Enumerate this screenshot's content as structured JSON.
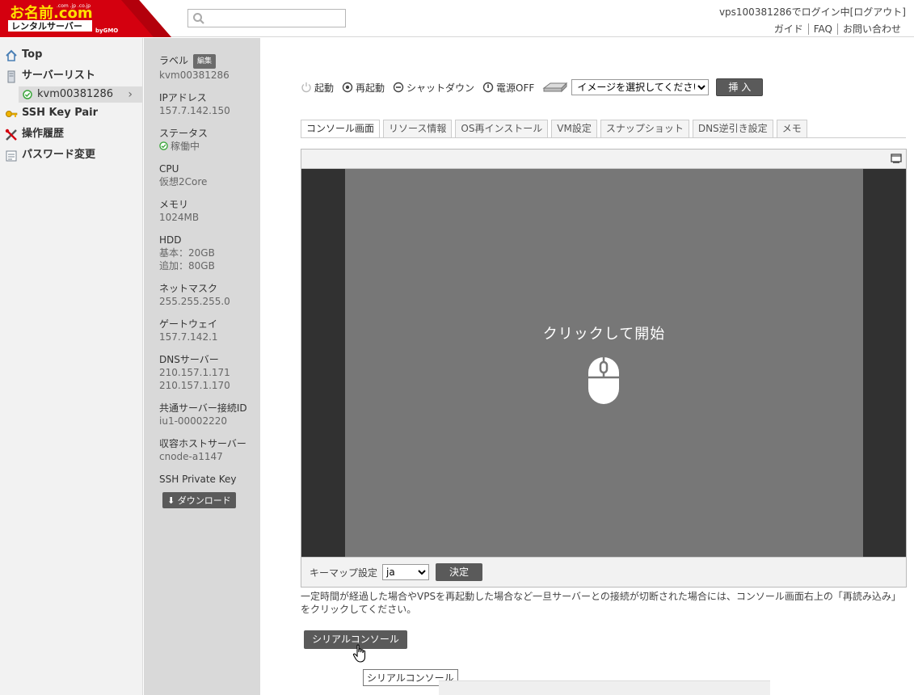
{
  "header": {
    "logo": {
      "brand_text": "お名前.com",
      "domains_text": ".com .jp .co.jp",
      "subtitle_text": "レンタルサーバー",
      "company_text": "byGMO"
    },
    "search": {
      "placeholder": ""
    },
    "account": {
      "login_status": "vps100381286でログイン中",
      "logout_label": "[ログアウト]",
      "links": [
        "ガイド",
        "FAQ",
        "お問い合わせ"
      ]
    }
  },
  "sidebar": {
    "items": [
      {
        "label": "Top",
        "icon": "home-icon"
      },
      {
        "label": "サーバーリスト",
        "icon": "server-icon"
      },
      {
        "label": "SSH Key Pair",
        "icon": "key-icon"
      },
      {
        "label": "操作履歴",
        "icon": "tools-icon"
      },
      {
        "label": "パスワード変更",
        "icon": "form-icon"
      }
    ],
    "selected_server": "kvm00381286"
  },
  "server_info": {
    "label_title": "ラベル",
    "edit_label": "編集",
    "label_value": "kvm00381286",
    "ip_title": "IPアドレス",
    "ip_value": "157.7.142.150",
    "status_title": "ステータス",
    "status_value": "稼働中",
    "cpu_title": "CPU",
    "cpu_value": "仮想2Core",
    "memory_title": "メモリ",
    "memory_value": "1024MB",
    "hdd_title": "HDD",
    "hdd_basic": "基本：20GB",
    "hdd_extra": "追加：80GB",
    "netmask_title": "ネットマスク",
    "netmask_value": "255.255.255.0",
    "gateway_title": "ゲートウェイ",
    "gateway_value": "157.7.142.1",
    "dns_title": "DNSサーバー",
    "dns_values": [
      "210.157.1.171",
      "210.157.1.170"
    ],
    "shared_id_title": "共通サーバー接続ID",
    "shared_id_value": "iu1-00002220",
    "host_title": "収容ホストサーバー",
    "host_value": "cnode-a1147",
    "ssh_key_title": "SSH Private Key",
    "download_label": "ダウンロード"
  },
  "power": {
    "start_label": "起動",
    "reboot_label": "再起動",
    "shutdown_label": "シャットダウン",
    "poweroff_label": "電源OFF",
    "iso_select_value": "イメージを選択してください",
    "insert_label": "挿 入"
  },
  "tabs": [
    "コンソール画面",
    "リソース情報",
    "OS再インストール",
    "VM設定",
    "スナップショット",
    "DNS逆引き設定",
    "メモ"
  ],
  "active_tab": "コンソール画面",
  "console": {
    "start_text": "クリックして開始",
    "keymap_label": "キーマップ設定",
    "keymap_value": "ja",
    "decide_label": "決定"
  },
  "note": "一定時間が経過した場合やVPSを再起動した場合など一旦サーバーとの接続が切断された場合には、コンソール画面右上の「再読み込み」をクリックしてください。",
  "serial_button_label": "シリアルコンソール",
  "tooltip_text": "シリアルコンソール",
  "colors": {
    "logo_red": "#d4000f",
    "logo_yellow": "#ffe100",
    "sidebar_bg": "#f2f2f2",
    "info_bg": "#d9d9d9",
    "button_dark": "#5a5a5a",
    "console_outer": "#313131",
    "console_inner": "#777777",
    "status_green": "#3aa63a"
  }
}
